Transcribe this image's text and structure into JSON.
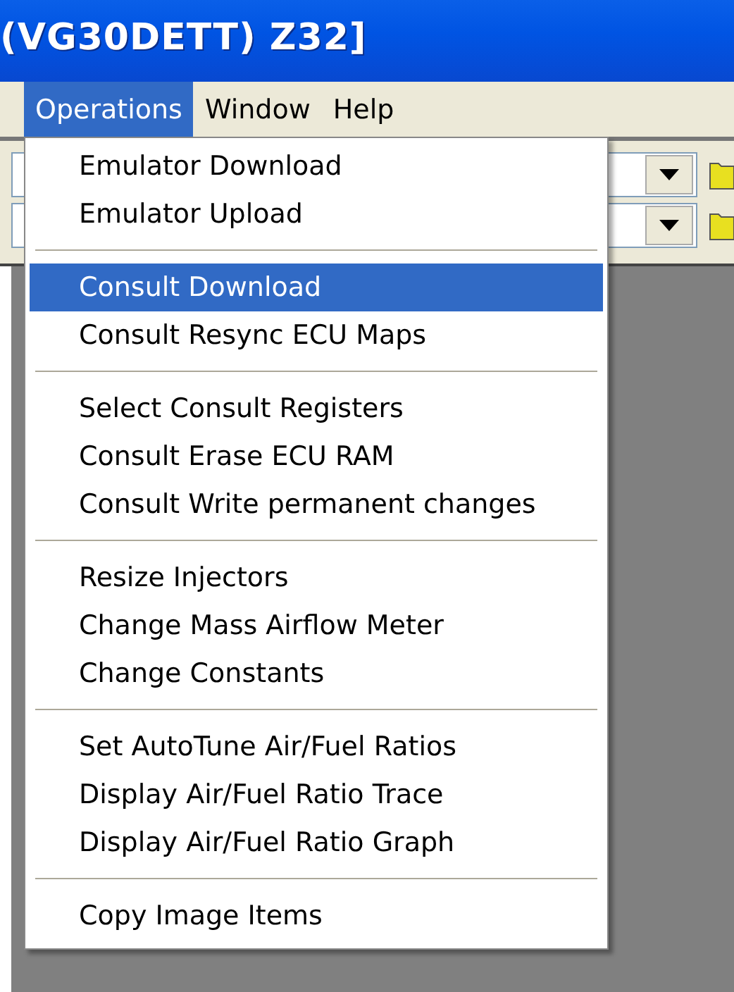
{
  "window": {
    "title": "(VG30DETT) Z32]"
  },
  "menubar": [
    {
      "label": "Operations",
      "selected": true
    },
    {
      "label": "Window",
      "selected": false
    },
    {
      "label": "Help",
      "selected": false
    }
  ],
  "menu": {
    "groups": [
      {
        "items": [
          {
            "label": "Emulator Download",
            "selected": false
          },
          {
            "label": "Emulator Upload",
            "selected": false
          }
        ]
      },
      {
        "items": [
          {
            "label": "Consult Download",
            "selected": true
          },
          {
            "label": "Consult Resync ECU Maps",
            "selected": false
          }
        ]
      },
      {
        "items": [
          {
            "label": "Select Consult Registers",
            "selected": false
          },
          {
            "label": "Consult Erase ECU RAM",
            "selected": false
          },
          {
            "label": "Consult Write permanent changes",
            "selected": false
          }
        ]
      },
      {
        "items": [
          {
            "label": "Resize Injectors",
            "selected": false
          },
          {
            "label": "Change Mass Airflow Meter",
            "selected": false
          },
          {
            "label": "Change Constants",
            "selected": false
          }
        ]
      },
      {
        "items": [
          {
            "label": "Set AutoTune Air/Fuel Ratios",
            "selected": false
          },
          {
            "label": "Display Air/Fuel Ratio Trace",
            "selected": false
          },
          {
            "label": "Display Air/Fuel Ratio Graph",
            "selected": false
          }
        ]
      },
      {
        "items": [
          {
            "label": "Copy Image Items",
            "selected": false
          }
        ]
      }
    ]
  }
}
